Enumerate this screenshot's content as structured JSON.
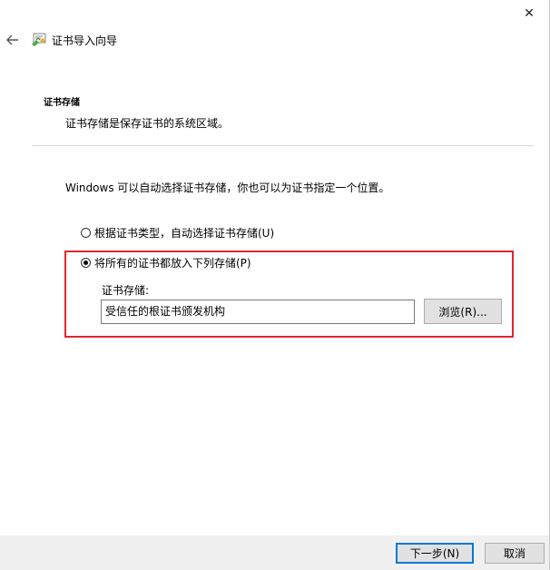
{
  "window": {
    "title": "证书导入向导",
    "close_glyph": "✕"
  },
  "header": {
    "section_title": "证书存储",
    "section_desc": "证书存储是保存证书的系统区域。"
  },
  "main": {
    "intro": "Windows 可以自动选择证书存储，你也可以为证书指定一个位置。",
    "options": [
      {
        "label": "根据证书类型，自动选择证书存储(U)",
        "checked": false
      },
      {
        "label": "将所有的证书都放入下列存储(P)",
        "checked": true
      }
    ],
    "store_label": "证书存储:",
    "store_value": "受信任的根证书颁发机构",
    "browse_label": "浏览(R)..."
  },
  "footer": {
    "next_label": "下一步(N)",
    "cancel_label": "取消"
  },
  "colors": {
    "highlight": "#e0262f",
    "accent": "#0078d7"
  },
  "icons": {
    "back": "back-arrow-icon",
    "wizard": "certificate-wizard-icon",
    "close": "close-icon"
  }
}
